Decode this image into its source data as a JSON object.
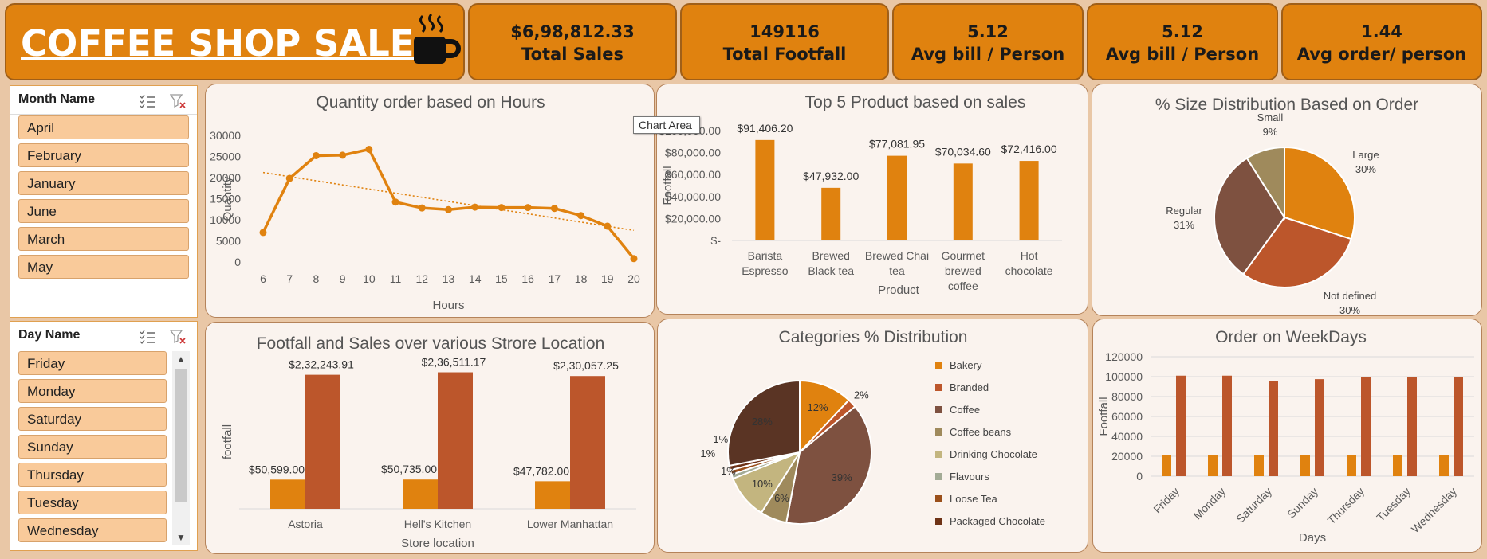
{
  "header": {
    "title": "COFFEE SHOP SALE",
    "icon": "coffee-cup-icon",
    "kpis": [
      {
        "value": "$6,98,812.33",
        "label": "Total Sales"
      },
      {
        "value": "149116",
        "label": "Total Footfall"
      },
      {
        "value": "5.12",
        "label": "Avg bill / Person"
      },
      {
        "value": "5.12",
        "label": "Avg bill / Person"
      },
      {
        "value": "1.44",
        "label": "Avg order/ person"
      }
    ]
  },
  "slicers": {
    "month": {
      "title": "Month Name",
      "items": [
        "April",
        "February",
        "January",
        "June",
        "March",
        "May"
      ]
    },
    "day": {
      "title": "Day Name",
      "items": [
        "Friday",
        "Monday",
        "Saturday",
        "Sunday",
        "Thursday",
        "Tuesday",
        "Wednesday"
      ]
    }
  },
  "tooltip": "Chart Area",
  "colors": {
    "accent": "#e0820f",
    "series2": "#bc562b",
    "panel": "#faf3ee",
    "background": "#e9c7a6"
  },
  "chart_data": [
    {
      "id": "hours",
      "type": "line",
      "title": "Quantity order based on Hours",
      "xlabel": "Hours",
      "ylabel": "Quantity",
      "x": [
        6,
        7,
        8,
        9,
        10,
        11,
        12,
        13,
        14,
        15,
        16,
        17,
        18,
        19,
        20
      ],
      "values": [
        7000,
        19800,
        25200,
        25300,
        26700,
        14200,
        12800,
        12400,
        13000,
        12900,
        12900,
        12700,
        11000,
        8500,
        800
      ],
      "trendline": {
        "start": 21200,
        "end": 7500
      },
      "ylim": [
        0,
        30000
      ],
      "yticks": [
        0,
        5000,
        10000,
        15000,
        20000,
        25000,
        30000
      ],
      "grid": false
    },
    {
      "id": "top5",
      "type": "bar",
      "title": "Top 5 Product based on sales",
      "xlabel": "Product",
      "ylabel": "Footfall",
      "categories": [
        "Barista Espresso",
        "Brewed Black tea",
        "Brewed Chai tea",
        "Gourmet brewed coffee",
        "Hot chocolate"
      ],
      "category_lines": [
        [
          "Barista",
          "Espresso"
        ],
        [
          "Brewed",
          "Black tea"
        ],
        [
          "Brewed Chai",
          "tea"
        ],
        [
          "Gourmet",
          "brewed",
          "coffee"
        ],
        [
          "Hot",
          "chocolate"
        ]
      ],
      "values": [
        91406.2,
        47932.0,
        77081.95,
        70034.6,
        72416.0
      ],
      "labels": [
        "$91,406.20",
        "$47,932.00",
        "$77,081.95",
        "$70,034.60",
        "$72,416.00"
      ],
      "ylim": [
        0,
        100000
      ],
      "yticks": [
        0,
        20000,
        40000,
        60000,
        80000,
        100000
      ],
      "ytick_labels": [
        "$-",
        "$20,000.00",
        "$40,000.00",
        "$60,000.00",
        "$80,000.00",
        "$100,000.00"
      ]
    },
    {
      "id": "size",
      "type": "pie",
      "title": "%  Size Distribution Based on Order",
      "slices": [
        {
          "name": "Large",
          "value": 30,
          "label": "30%",
          "color": "#e0820f"
        },
        {
          "name": "Not defined",
          "value": 30,
          "label": "30%",
          "color": "#bc562b"
        },
        {
          "name": "Regular",
          "value": 31,
          "label": "31%",
          "color": "#7e5140"
        },
        {
          "name": "Small",
          "value": 9,
          "label": "9%",
          "color": "#9f8a5c"
        }
      ]
    },
    {
      "id": "location",
      "type": "bar",
      "title": "Footfall and Sales over various Strore Location",
      "xlabel": "Store location",
      "ylabel": "footfall",
      "categories": [
        "Astoria",
        "Hell's Kitchen",
        "Lower Manhattan"
      ],
      "series": [
        {
          "values": [
            50599.0,
            50735.0,
            47782.0
          ],
          "labels": [
            "$50,599.00",
            "$50,735.00",
            "$47,782.00"
          ],
          "color": "#e0820f"
        },
        {
          "values": [
            232243.91,
            236511.17,
            230057.25
          ],
          "labels": [
            "$2,32,243.91",
            "$2,36,511.17",
            "$2,30,057.25"
          ],
          "color": "#bc562b"
        }
      ],
      "ylim": [
        0,
        240000
      ],
      "grid": false
    },
    {
      "id": "categories",
      "type": "pie",
      "title": "Categories  % Distribution",
      "legend": "right",
      "slices": [
        {
          "name": "Bakery",
          "value": 12,
          "label": "12%",
          "color": "#e0820f"
        },
        {
          "name": "Branded",
          "value": 2,
          "label": "2%",
          "color": "#bc562b"
        },
        {
          "name": "Coffee",
          "value": 39,
          "label": "39%",
          "color": "#7e5140"
        },
        {
          "name": "Coffee beans",
          "value": 6,
          "label": "6%",
          "color": "#9f8a5c"
        },
        {
          "name": "Drinking Chocolate",
          "value": 10,
          "label": "10%",
          "color": "#c3b57f"
        },
        {
          "name": "Flavours",
          "value": 1,
          "label": "1%",
          "color": "#a3ab96"
        },
        {
          "name": "Loose Tea",
          "value": 1,
          "label": "1%",
          "color": "#9a4f1a"
        },
        {
          "name": "Packaged Chocolate",
          "value": 1,
          "label": "1%",
          "color": "#6e3216"
        },
        {
          "name": "",
          "value": 28,
          "label": "28%",
          "color": "#5a3424"
        }
      ]
    },
    {
      "id": "weekdays",
      "type": "bar",
      "title": "Order on WeekDays",
      "xlabel": "Days",
      "ylabel": "Footfall",
      "categories": [
        "Friday",
        "Monday",
        "Saturday",
        "Sunday",
        "Thursday",
        "Tuesday",
        "Wednesday"
      ],
      "series": [
        {
          "values": [
            21500,
            21500,
            21000,
            21000,
            21500,
            21000,
            21500
          ],
          "color": "#e0820f"
        },
        {
          "values": [
            101000,
            101000,
            96000,
            97500,
            100000,
            99500,
            100000
          ],
          "color": "#bc562b"
        }
      ],
      "ylim": [
        0,
        120000
      ],
      "yticks": [
        0,
        20000,
        40000,
        60000,
        80000,
        100000,
        120000
      ],
      "grid": true
    }
  ]
}
